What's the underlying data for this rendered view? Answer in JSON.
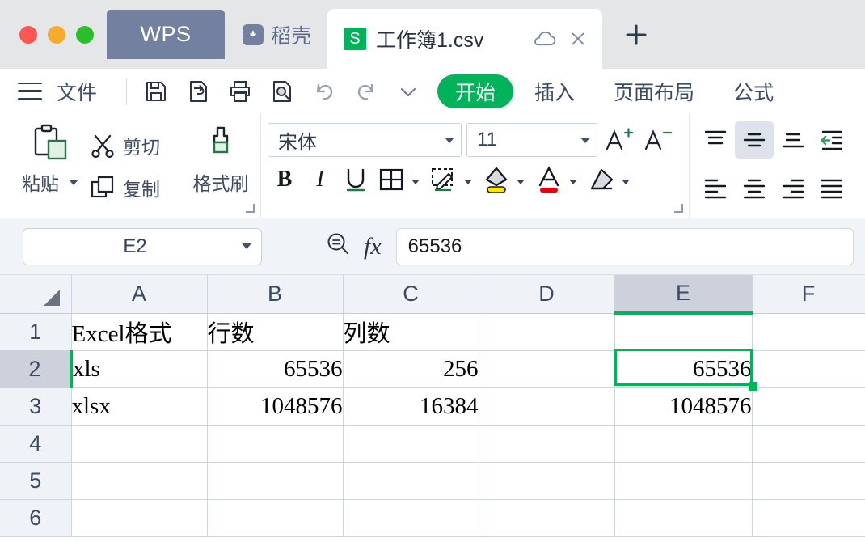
{
  "titlebar": {
    "wps_button": "WPS",
    "docer_label": "稻壳",
    "docer_icon": "leaf-icon",
    "file_badge": "S",
    "file_name": "工作簿1.csv",
    "cloud_icon": "cloud-icon",
    "close_icon": "close-icon",
    "new_tab_icon": "plus-icon",
    "window_controls": [
      "close-dot",
      "minimize-dot",
      "maximize-dot"
    ]
  },
  "menubar": {
    "menu_icon": "hamburger-icon",
    "file_label": "文件",
    "quick_access": [
      {
        "name": "save-icon",
        "title": "保存"
      },
      {
        "name": "export-pdf-icon",
        "title": "输出为PDF"
      },
      {
        "name": "print-icon",
        "title": "打印"
      },
      {
        "name": "print-preview-icon",
        "title": "打印预览"
      },
      {
        "name": "undo-icon",
        "title": "撤销"
      },
      {
        "name": "redo-icon",
        "title": "恢复"
      },
      {
        "name": "chevron-down-icon",
        "title": "更多"
      }
    ],
    "tabs": [
      {
        "label": "开始",
        "active": true
      },
      {
        "label": "插入",
        "active": false
      },
      {
        "label": "页面布局",
        "active": false
      },
      {
        "label": "公式",
        "active": false
      }
    ]
  },
  "ribbon": {
    "clipboard": {
      "paste_label": "粘贴",
      "cut_label": "剪切",
      "copy_label": "复制",
      "format_painter_label": "格式刷"
    },
    "font": {
      "font_family": "宋体",
      "font_size": "11",
      "grow_font": "A",
      "shrink_font": "A",
      "bold": "B",
      "italic": "I",
      "underline": "U",
      "borders_icon": "borders-icon",
      "draw-border_icon": "draw-border-icon",
      "fill-color_icon": "fill-color-icon",
      "font-color_icon": "font-color-icon",
      "clear-format_icon": "clear-format-icon",
      "fill_color": "#ffe600",
      "text_color": "#e60012"
    },
    "alignment": {
      "buttons": [
        "align-top-icon",
        "align-middle-icon",
        "align-bottom-icon",
        "decrease-indent-icon",
        "align-left-icon",
        "align-center-icon",
        "align-right-icon",
        "align-justify-icon"
      ],
      "selected": "align-middle-icon"
    }
  },
  "formula_bar": {
    "name_box_value": "E2",
    "search_icon": "formula-search-icon",
    "fx_icon": "fx",
    "formula_value": "65536"
  },
  "sheet": {
    "columns": [
      "A",
      "B",
      "C",
      "D",
      "E",
      "F"
    ],
    "selected_column": "E",
    "rows": [
      "1",
      "2",
      "3",
      "4",
      "5",
      "6"
    ],
    "selected_row": "2",
    "active_cell": "E2",
    "data": [
      {
        "row": "1",
        "cells": [
          {
            "v": "Excel格式",
            "align": "txt"
          },
          {
            "v": "行数",
            "align": "txt"
          },
          {
            "v": "列数",
            "align": "txt"
          },
          {
            "v": "",
            "align": "txt"
          },
          {
            "v": "",
            "align": "num"
          },
          {
            "v": "",
            "align": "txt"
          }
        ]
      },
      {
        "row": "2",
        "cells": [
          {
            "v": "xls",
            "align": "txt"
          },
          {
            "v": "65536",
            "align": "num"
          },
          {
            "v": "256",
            "align": "num"
          },
          {
            "v": "",
            "align": "txt"
          },
          {
            "v": "65536",
            "align": "num"
          },
          {
            "v": "",
            "align": "txt"
          }
        ]
      },
      {
        "row": "3",
        "cells": [
          {
            "v": "xlsx",
            "align": "txt"
          },
          {
            "v": "1048576",
            "align": "num"
          },
          {
            "v": "16384",
            "align": "num"
          },
          {
            "v": "",
            "align": "txt"
          },
          {
            "v": "1048576",
            "align": "num"
          },
          {
            "v": "",
            "align": "txt"
          }
        ]
      },
      {
        "row": "4",
        "cells": [
          {
            "v": "",
            "align": "txt"
          },
          {
            "v": "",
            "align": "txt"
          },
          {
            "v": "",
            "align": "txt"
          },
          {
            "v": "",
            "align": "txt"
          },
          {
            "v": "",
            "align": "txt"
          },
          {
            "v": "",
            "align": "txt"
          }
        ]
      },
      {
        "row": "5",
        "cells": [
          {
            "v": "",
            "align": "txt"
          },
          {
            "v": "",
            "align": "txt"
          },
          {
            "v": "",
            "align": "txt"
          },
          {
            "v": "",
            "align": "txt"
          },
          {
            "v": "",
            "align": "txt"
          },
          {
            "v": "",
            "align": "txt"
          }
        ]
      },
      {
        "row": "6",
        "cells": [
          {
            "v": "",
            "align": "txt"
          },
          {
            "v": "",
            "align": "txt"
          },
          {
            "v": "",
            "align": "txt"
          },
          {
            "v": "",
            "align": "txt"
          },
          {
            "v": "",
            "align": "txt"
          },
          {
            "v": "",
            "align": "txt"
          }
        ]
      }
    ]
  },
  "colors": {
    "accent_green": "#00b259",
    "titlebar_bg": "#e5e6e7",
    "wps_blue": "#73809f",
    "header_bg": "#eff2f6",
    "selected_header_bg": "#ccd1dc"
  }
}
